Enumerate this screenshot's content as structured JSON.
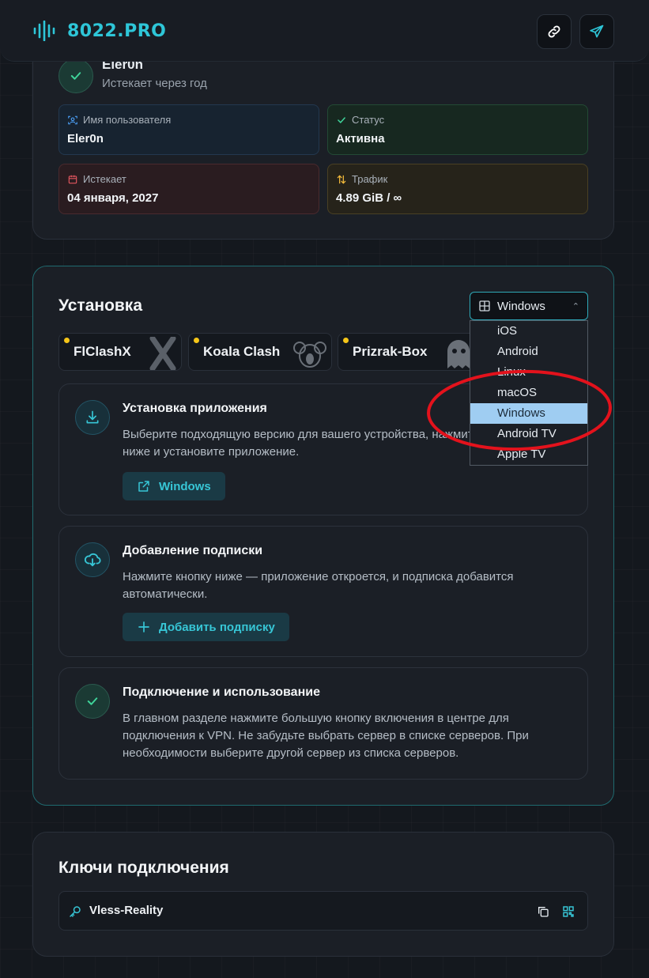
{
  "header": {
    "brand": "8022.PRO",
    "link_icon": "link-icon",
    "telegram_icon": "telegram-icon"
  },
  "user": {
    "name": "Eler0n",
    "subtitle": "Истекает через год",
    "fields": {
      "username_label": "Имя пользователя",
      "username_value": "Eler0n",
      "status_label": "Статус",
      "status_value": "Активна",
      "expires_label": "Истекает",
      "expires_value": "04 января, 2027",
      "traffic_label": "Трафик",
      "traffic_value": "4.89 GiB / ∞"
    }
  },
  "install": {
    "title": "Установка",
    "platform_selected": "Windows",
    "platform_options": [
      "iOS",
      "Android",
      "Linux",
      "macOS",
      "Windows",
      "Android TV",
      "Apple TV"
    ],
    "apps": [
      "FlClashX",
      "Koala Clash",
      "Prizrak-Box"
    ],
    "steps": {
      "install_title": "Установка приложения",
      "install_text": "Выберите подходящую версию для вашего устройства, нажмите на кнопку ниже и установите приложение.",
      "install_button": "Windows",
      "subscribe_title": "Добавление подписки",
      "subscribe_text": "Нажмите кнопку ниже — приложение откроется, и подписка добавится автоматически.",
      "subscribe_button": "Добавить подписку",
      "connect_title": "Подключение и использование",
      "connect_text": "В главном разделе нажмите большую кнопку включения в центре для подключения к VPN. Не забудьте выбрать сервер в списке серверов. При необходимости выберите другой сервер из списка серверов."
    }
  },
  "keys": {
    "title": "Ключи подключения",
    "items": [
      {
        "name": "Vless-Reality"
      }
    ]
  },
  "colors": {
    "accent": "#2ec6d8",
    "annotation": "#e3121c",
    "selected_option": "#9fcdf2"
  }
}
